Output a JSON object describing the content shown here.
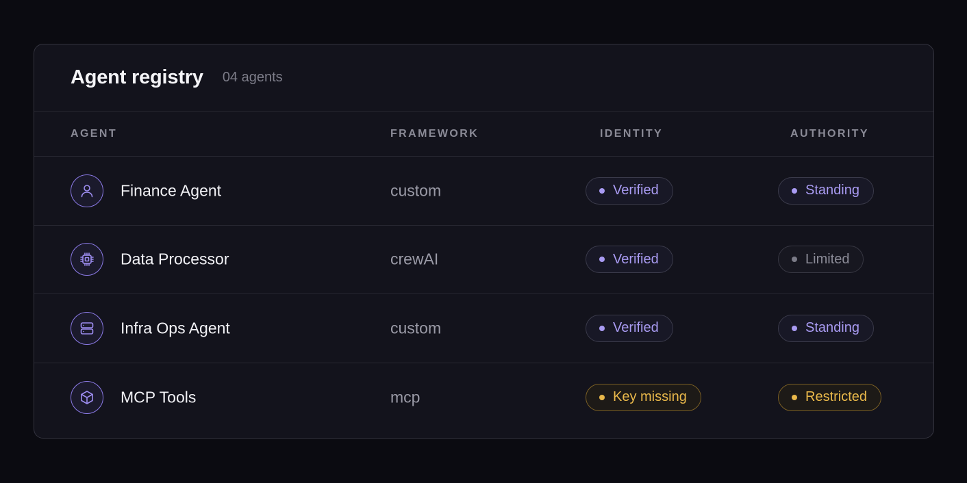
{
  "header": {
    "title": "Agent registry",
    "count": "04 agents"
  },
  "columns": {
    "agent": "AGENT",
    "framework": "FRAMEWORK",
    "identity": "IDENTITY",
    "authority": "AUTHORITY"
  },
  "rows": [
    {
      "name": "Finance Agent",
      "icon": "user-icon",
      "framework": "custom",
      "identity": {
        "label": "Verified",
        "tone": "purple"
      },
      "authority": {
        "label": "Standing",
        "tone": "purple"
      }
    },
    {
      "name": "Data Processor",
      "icon": "cpu-chip-icon",
      "framework": "crewAI",
      "identity": {
        "label": "Verified",
        "tone": "purple"
      },
      "authority": {
        "label": "Limited",
        "tone": "gray"
      }
    },
    {
      "name": "Infra Ops Agent",
      "icon": "server-icon",
      "framework": "custom",
      "identity": {
        "label": "Verified",
        "tone": "purple"
      },
      "authority": {
        "label": "Standing",
        "tone": "purple"
      }
    },
    {
      "name": "MCP Tools",
      "icon": "cube-icon",
      "framework": "mcp",
      "identity": {
        "label": "Key missing",
        "tone": "amber"
      },
      "authority": {
        "label": "Restricted",
        "tone": "amber"
      }
    }
  ],
  "colors": {
    "accent": "#a99bf2",
    "warning": "#e9b84a",
    "muted": "#8b8b97",
    "background": "#0b0b11",
    "card": "#13131c"
  }
}
